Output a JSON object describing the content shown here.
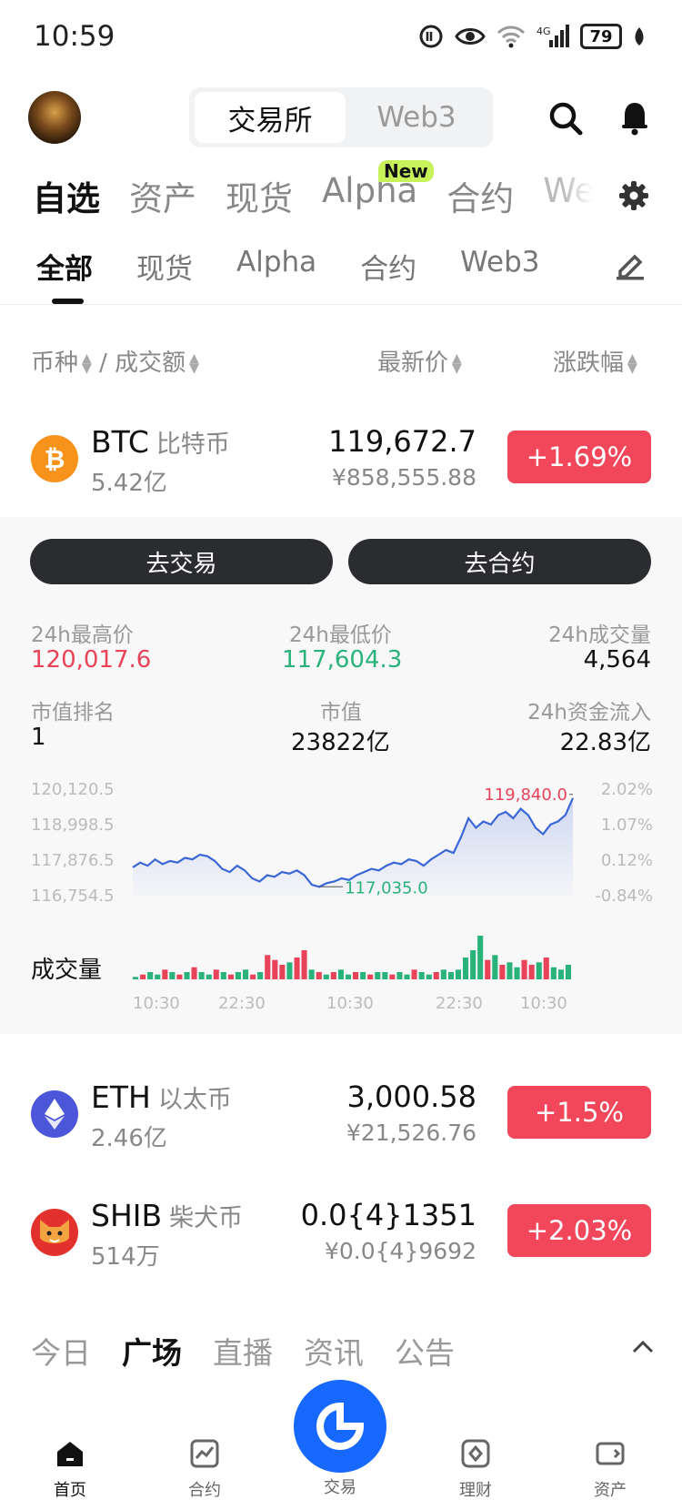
{
  "status": {
    "time": "10:59",
    "battery": "79"
  },
  "header": {
    "switch_active": "交易所",
    "switch_inactive": "Web3"
  },
  "tabs1": [
    "自选",
    "资产",
    "现货",
    "Alpha",
    "合约",
    "We"
  ],
  "tabs1_badge": "New",
  "tabs2": [
    "全部",
    "现货",
    "Alpha",
    "合约",
    "Web3"
  ],
  "list_header": {
    "coin": "币种",
    "sep": "/",
    "turnover": "成交额",
    "price": "最新价",
    "change": "涨跌幅"
  },
  "coins": [
    {
      "symbol": "BTC",
      "name": "比特币",
      "volume": "5.42亿",
      "price": "119,672.7",
      "price_cny": "¥858,555.88",
      "change": "+1.69%",
      "icon_color": "#f7931a",
      "icon": "bitcoin-icon"
    },
    {
      "symbol": "ETH",
      "name": "以太币",
      "volume": "2.46亿",
      "price": "3,000.58",
      "price_cny": "¥21,526.76",
      "change": "+1.5%",
      "icon_color": "#4b57d8",
      "icon": "ethereum-icon"
    },
    {
      "symbol": "SHIB",
      "name": "柴犬币",
      "volume": "514万",
      "price": "0.0{4}1351",
      "price_cny": "¥0.0{4}9692",
      "change": "+2.03%",
      "icon_color": "#e2312d",
      "icon": "shiba-icon"
    }
  ],
  "panel": {
    "trade_btn": "去交易",
    "contract_btn": "去合约",
    "stats": {
      "high_label": "24h最高价",
      "high": "120,017.6",
      "low_label": "24h最低价",
      "low": "117,604.3",
      "vol_label": "24h成交量",
      "vol": "4,564",
      "rank_label": "市值排名",
      "rank": "1",
      "cap_label": "市值",
      "cap": "23822亿",
      "flow_label": "24h资金流入",
      "flow": "22.83亿"
    },
    "volume_label": "成交量"
  },
  "chart_data": {
    "type": "line",
    "title": "",
    "y_left_ticks": [
      "120,120.5",
      "118,998.5",
      "117,876.5",
      "116,754.5"
    ],
    "y_right_ticks": [
      "2.02%",
      "1.07%",
      "0.12%",
      "-0.84%"
    ],
    "x_ticks": [
      "10:30",
      "22:30",
      "10:30",
      "22:30",
      "10:30"
    ],
    "ylim": [
      116754.5,
      120120.5
    ],
    "max_label": "119,840.0",
    "min_label": "117,035.0",
    "series": [
      {
        "values": [
          117650,
          117800,
          117700,
          117900,
          117750,
          117850,
          117800,
          117950,
          117900,
          118050,
          118000,
          117850,
          117600,
          117500,
          117700,
          117550,
          117300,
          117200,
          117400,
          117350,
          117500,
          117450,
          117550,
          117400,
          117100,
          117035,
          117150,
          117200,
          117300,
          117250,
          117400,
          117500,
          117600,
          117550,
          117700,
          117800,
          117750,
          117900,
          117850,
          117700,
          117900,
          118050,
          118200,
          118100,
          118600,
          119200,
          118900,
          119100,
          119000,
          119300,
          119400,
          119200,
          119500,
          119300,
          118900,
          118700,
          119000,
          119100,
          119300,
          119840
        ]
      }
    ],
    "volume": [
      1,
      2,
      3,
      2,
      4,
      3,
      2,
      3,
      5,
      3,
      2,
      4,
      3,
      2,
      3,
      4,
      2,
      3,
      10,
      8,
      6,
      7,
      9,
      12,
      4,
      3,
      2,
      3,
      4,
      2,
      3,
      3,
      2,
      3,
      3,
      2,
      3,
      2,
      4,
      3,
      2,
      3,
      4,
      3,
      4,
      9,
      12,
      18,
      8,
      10,
      6,
      7,
      5,
      8,
      6,
      7,
      9,
      5,
      4,
      6
    ],
    "volume_up": [
      true,
      false,
      true,
      true,
      false,
      true,
      false,
      true,
      false,
      true,
      true,
      false,
      true,
      false,
      true,
      true,
      false,
      true,
      false,
      false,
      false,
      true,
      false,
      false,
      true,
      false,
      true,
      false,
      true,
      true,
      false,
      true,
      false,
      true,
      true,
      false,
      true,
      true,
      false,
      true,
      true,
      false,
      true,
      true,
      true,
      true,
      true,
      true,
      false,
      true,
      false,
      true,
      true,
      false,
      false,
      true,
      false,
      true,
      true,
      true
    ]
  },
  "bottom_tabs": [
    "今日",
    "广场",
    "直播",
    "资讯",
    "公告"
  ],
  "nav": [
    "首页",
    "合约",
    "交易",
    "理财",
    "资产"
  ]
}
